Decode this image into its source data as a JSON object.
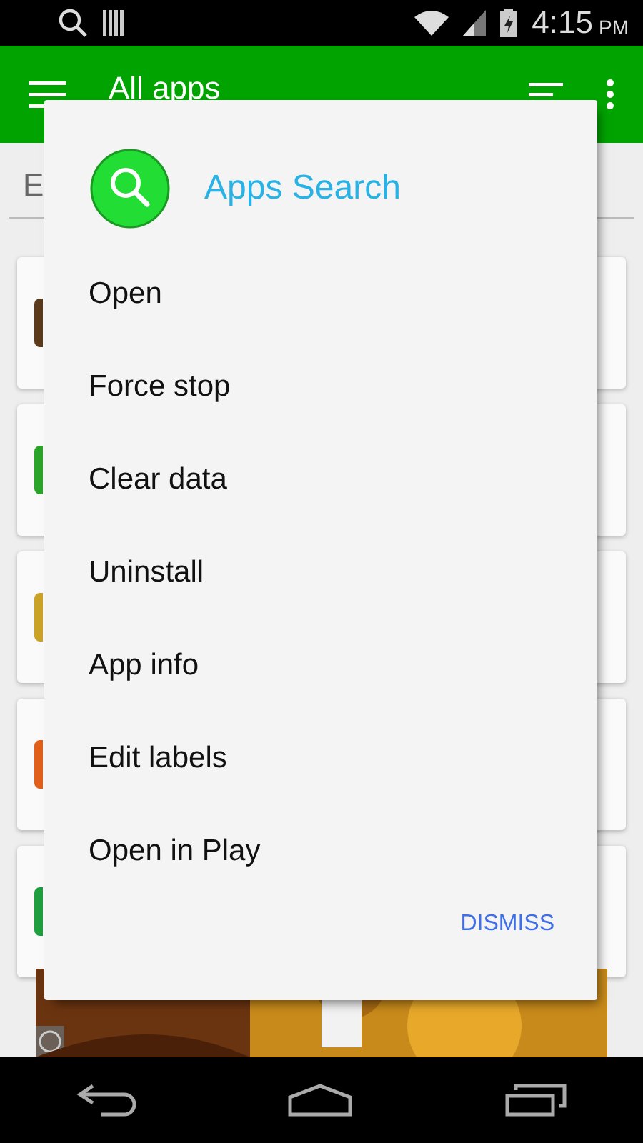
{
  "status_bar": {
    "time": "4:15",
    "meridiem": "PM"
  },
  "toolbar": {
    "title": "All apps"
  },
  "search": {
    "value": "E"
  },
  "app_cards": [
    {
      "color": "#5a3a1a"
    },
    {
      "color": "#2aa52a"
    },
    {
      "color": "#c9a227"
    },
    {
      "color": "#e0601a"
    },
    {
      "color": "#1e9e3e"
    }
  ],
  "dialog": {
    "title": "Apps Search",
    "items": [
      "Open",
      "Force stop",
      "Clear data",
      "Uninstall",
      "App info",
      "Edit labels",
      "Open in Play"
    ],
    "dismiss": "DISMISS"
  }
}
